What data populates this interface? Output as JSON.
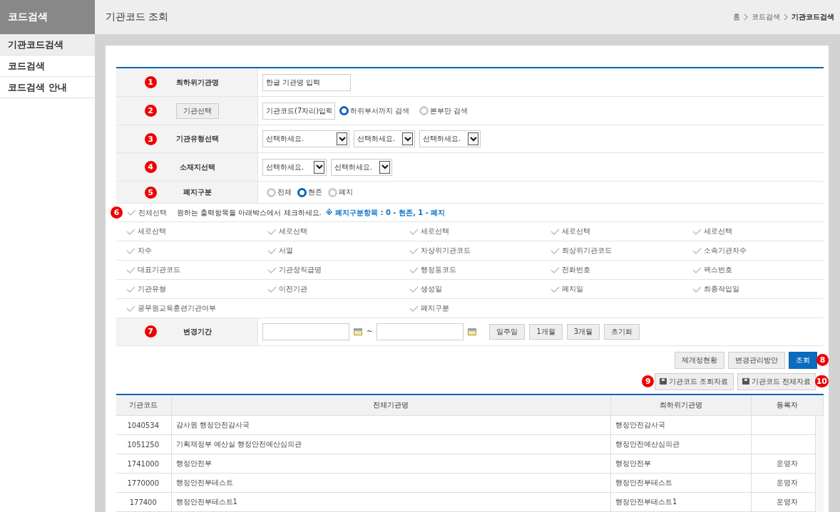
{
  "sidebar": {
    "title": "코드검색",
    "items": [
      {
        "label": "기관코드검색",
        "selected": true
      },
      {
        "label": "코드검색",
        "selected": false
      },
      {
        "label": "코드검색 안내",
        "selected": false
      }
    ]
  },
  "header": {
    "title": "기관코드 조회",
    "breadcrumb": [
      "홈",
      "코드검색",
      "기관코드검색"
    ]
  },
  "form": [
    {
      "kind": "text",
      "badge": "1",
      "label": "최하위기관명",
      "value": "한글 기관명 입력"
    },
    {
      "kind": "org",
      "badge": "2",
      "button": "기관선택",
      "value": "기관코드(7자리)입력",
      "options": [
        {
          "label": "하위부서까지 검색",
          "selected": true
        },
        {
          "label": "본부만 검색",
          "selected": false
        }
      ]
    },
    {
      "kind": "selects",
      "badge": "3",
      "label": "기관유형선택",
      "selects": [
        "선택하세요.",
        "선택하세요.",
        "선택하세요."
      ]
    },
    {
      "kind": "selects",
      "badge": "4",
      "label": "소재지선택",
      "selects": [
        "선택하세요.",
        "선택하세요."
      ]
    },
    {
      "kind": "radios",
      "badge": "5",
      "label": "폐지구분",
      "options": [
        {
          "label": "전체",
          "selected": false
        },
        {
          "label": "현존",
          "selected": true
        },
        {
          "label": "폐지",
          "selected": false
        }
      ]
    }
  ],
  "columns_picker": {
    "badge": "6",
    "select_all": {
      "label": "전체선택",
      "checked": false
    },
    "hint": "원하는 출력항목을 아래박스에서 체크하세요.",
    "note": "※ 폐지구분항목 : 0 - 현존, 1 - 폐지",
    "items": [
      {
        "label": "세로선택",
        "checked": false,
        "kind": "normal"
      },
      {
        "label": "세로선택",
        "checked": false,
        "kind": "normal"
      },
      {
        "label": "세로선택",
        "checked": false,
        "kind": "normal"
      },
      {
        "label": "세로선택",
        "checked": false,
        "kind": "normal"
      },
      {
        "label": "세로선택",
        "checked": false,
        "kind": "normal"
      },
      {
        "label": "차수",
        "checked": false,
        "kind": "normal"
      },
      {
        "label": "서열",
        "checked": false,
        "kind": "normal"
      },
      {
        "label": "차상위기관코드",
        "checked": false,
        "kind": "normal"
      },
      {
        "label": "최상위기관코드",
        "checked": false,
        "kind": "normal"
      },
      {
        "label": "소속기관차수",
        "checked": false,
        "kind": "normal"
      },
      {
        "label": "대표기관코드",
        "checked": false,
        "kind": "normal"
      },
      {
        "label": "기관장직급명",
        "checked": false,
        "kind": "normal"
      },
      {
        "label": "행정동코드",
        "checked": false,
        "kind": "normal"
      },
      {
        "label": "전화번호",
        "checked": false,
        "kind": "normal"
      },
      {
        "label": "팩스번호",
        "checked": false,
        "kind": "normal"
      },
      {
        "label": "기관유형",
        "checked": false,
        "kind": "normal"
      },
      {
        "label": "이전기관",
        "checked": false,
        "kind": "normal"
      },
      {
        "label": "생성일",
        "checked": false,
        "kind": "normal"
      },
      {
        "label": "폐지일",
        "checked": false,
        "kind": "normal"
      },
      {
        "label": "최종작업일",
        "checked": false,
        "kind": "normal"
      },
      {
        "label": "공무원교육훈련기관여부",
        "checked": false,
        "kind": "wide"
      },
      {
        "label": "폐지구분",
        "checked": false,
        "kind": "normal"
      }
    ]
  },
  "period": {
    "badge": "7",
    "label": "변경기간",
    "separator": "~",
    "buttons": [
      "일주일",
      "1개월",
      "3개월",
      "초기화"
    ]
  },
  "actions": {
    "badge": "8",
    "buttons": [
      {
        "label": "제개정현황",
        "primary": false
      },
      {
        "label": "변경관리방안",
        "primary": false
      },
      {
        "label": "조회",
        "primary": true
      }
    ]
  },
  "downloads": [
    {
      "badge": "9",
      "label": "기관코드 조회자료"
    },
    {
      "badge": "10",
      "label": "기관코드 전체자료"
    }
  ],
  "table": {
    "columns": [
      "기관코드",
      "전체기관명",
      "최하위기관명",
      "등록자"
    ],
    "rows": [
      [
        "1040534",
        "감사원 행정안전감사국",
        "행정안전감사국",
        ""
      ],
      [
        "1051250",
        "기획재정부 예산실 행정안전예산심의관",
        "행정안전예산심의관",
        ""
      ],
      [
        "1741000",
        "행정안전부",
        "행정안전부",
        "운영자"
      ],
      [
        "1770000",
        "행정안전부테스트",
        "행정안전부테스트",
        "운영자"
      ],
      [
        "177400",
        "행정안전부테스트1",
        "행정안전부테스트1",
        "운영자"
      ]
    ]
  }
}
